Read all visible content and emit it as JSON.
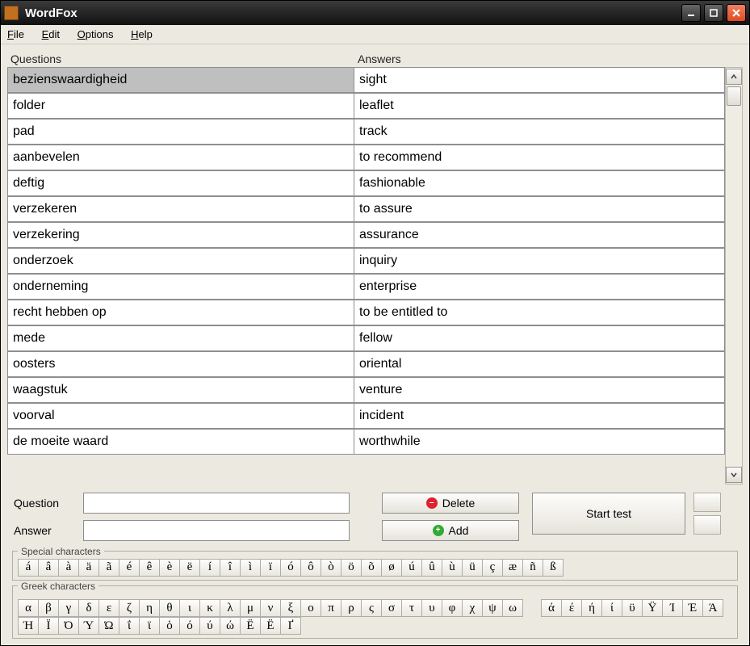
{
  "window": {
    "title": "WordFox"
  },
  "menu": {
    "file": "File",
    "edit": "Edit",
    "options": "Options",
    "help": "Help"
  },
  "headers": {
    "questions": "Questions",
    "answers": "Answers"
  },
  "rows": [
    {
      "q": "bezienswaardigheid",
      "a": "sight",
      "selected": true
    },
    {
      "q": "folder",
      "a": "leaflet"
    },
    {
      "q": "pad",
      "a": "track"
    },
    {
      "q": "aanbevelen",
      "a": "to recommend"
    },
    {
      "q": "deftig",
      "a": "fashionable"
    },
    {
      "q": "verzekeren",
      "a": "to assure"
    },
    {
      "q": "verzekering",
      "a": "assurance"
    },
    {
      "q": "onderzoek",
      "a": "inquiry"
    },
    {
      "q": "onderneming",
      "a": "enterprise"
    },
    {
      "q": "recht hebben op",
      "a": "to be entitled to"
    },
    {
      "q": "mede",
      "a": "fellow"
    },
    {
      "q": "oosters",
      "a": "oriental"
    },
    {
      "q": "waagstuk",
      "a": "venture"
    },
    {
      "q": "voorval",
      "a": "incident"
    },
    {
      "q": "de moeite waard",
      "a": "worthwhile"
    }
  ],
  "form": {
    "question_label": "Question",
    "answer_label": "Answer",
    "question_value": "",
    "answer_value": ""
  },
  "buttons": {
    "delete": "Delete",
    "add": "Add",
    "start": "Start test"
  },
  "special": {
    "legend": "Special characters",
    "chars": [
      "á",
      "â",
      "à",
      "ä",
      "ã",
      "é",
      "ê",
      "è",
      "ë",
      "í",
      "î",
      "ì",
      "ï",
      "ó",
      "ô",
      "ò",
      "ö",
      "õ",
      "ø",
      "ú",
      "û",
      "ù",
      "ü",
      "ç",
      "æ",
      "ñ",
      "ß"
    ]
  },
  "greek": {
    "legend": "Greek characters",
    "chars_a": [
      "α",
      "β",
      "γ",
      "δ",
      "ε",
      "ζ",
      "η",
      "θ",
      "ι",
      "κ",
      "λ",
      "μ",
      "ν",
      "ξ",
      "ο",
      "π",
      "ρ",
      "ς",
      "σ",
      "τ",
      "υ",
      "φ",
      "χ",
      "ψ",
      "ω"
    ],
    "chars_b": [
      "ά",
      "έ",
      "ή",
      "ί",
      "ϋ",
      "Ϋ",
      "Ί",
      "Έ",
      "Ά",
      "Ή",
      "Ϊ",
      "Ό",
      "Ύ",
      "Ώ",
      "ΐ",
      "ϊ",
      "ὁ",
      "ό",
      "ύ",
      "ώ",
      "Ё",
      "Ё",
      "Ґ"
    ]
  }
}
